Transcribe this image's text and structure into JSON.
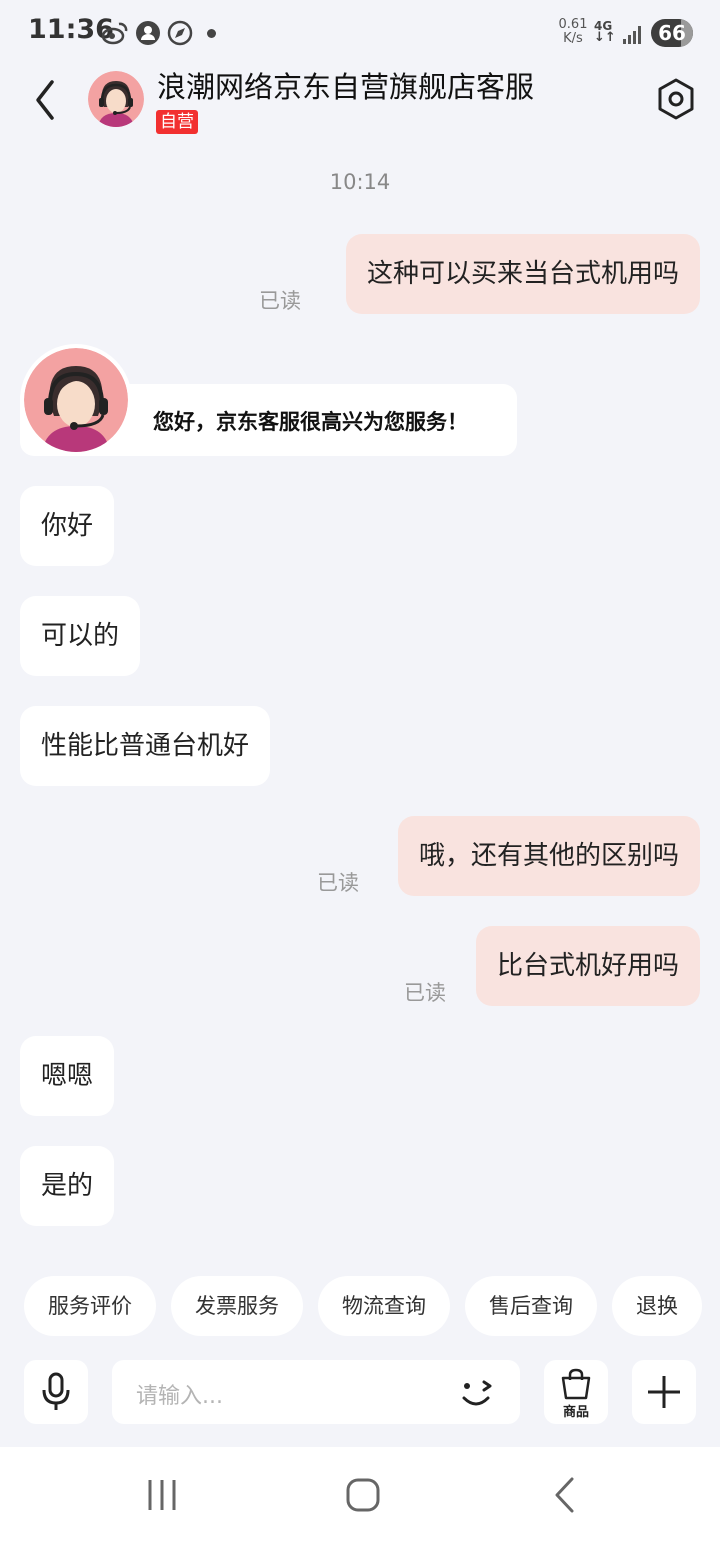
{
  "status_bar": {
    "time": "11:36",
    "speed_value": "0.61",
    "speed_unit": "K/s",
    "network": "4G",
    "battery": "66",
    "icons": [
      "weibo-icon",
      "person-icon",
      "compass-icon",
      "dot-icon",
      "signal-icon"
    ]
  },
  "header": {
    "title": "浪潮网络京东自营旗舰店客服",
    "badge": "自营"
  },
  "chat": {
    "timestamp": "10:14",
    "read_label": "已读",
    "welcome": "您好，京东客服很高兴为您服务！",
    "messages": [
      {
        "side": "out",
        "text": "这种可以买来当台式机用吗"
      },
      {
        "side": "in",
        "text": "你好"
      },
      {
        "side": "in",
        "text": "可以的"
      },
      {
        "side": "in",
        "text": "性能比普通台机好"
      },
      {
        "side": "out",
        "text": "哦，还有其他的区别吗"
      },
      {
        "side": "out",
        "text": "比台式机好用吗"
      },
      {
        "side": "in",
        "text": "嗯嗯"
      },
      {
        "side": "in",
        "text": "是的"
      }
    ]
  },
  "quick_actions": [
    "服务评价",
    "发票服务",
    "物流查询",
    "售后查询",
    "退换"
  ],
  "input": {
    "placeholder": "请输入...",
    "goods_label": "商品"
  },
  "colors": {
    "background": "#f3f4f9",
    "outgoing_bubble": "#f9e3df",
    "incoming_bubble": "#ffffff",
    "badge": "#f23030"
  }
}
